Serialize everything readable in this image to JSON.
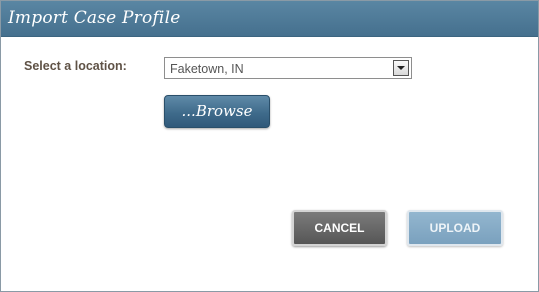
{
  "dialog": {
    "title": "Import Case Profile"
  },
  "location": {
    "label": "Select a location:",
    "selected": "Faketown, IN"
  },
  "buttons": {
    "browse": "...Browse",
    "cancel": "CANCEL",
    "upload": "UPLOAD"
  },
  "colors": {
    "titlebar": "#4d7896",
    "browse": "#3f6b8b",
    "cancel": "#666666",
    "upload": "#87abc6",
    "label_text": "#5f5246"
  },
  "icons": {
    "dropdown": "chevron-down-icon"
  }
}
